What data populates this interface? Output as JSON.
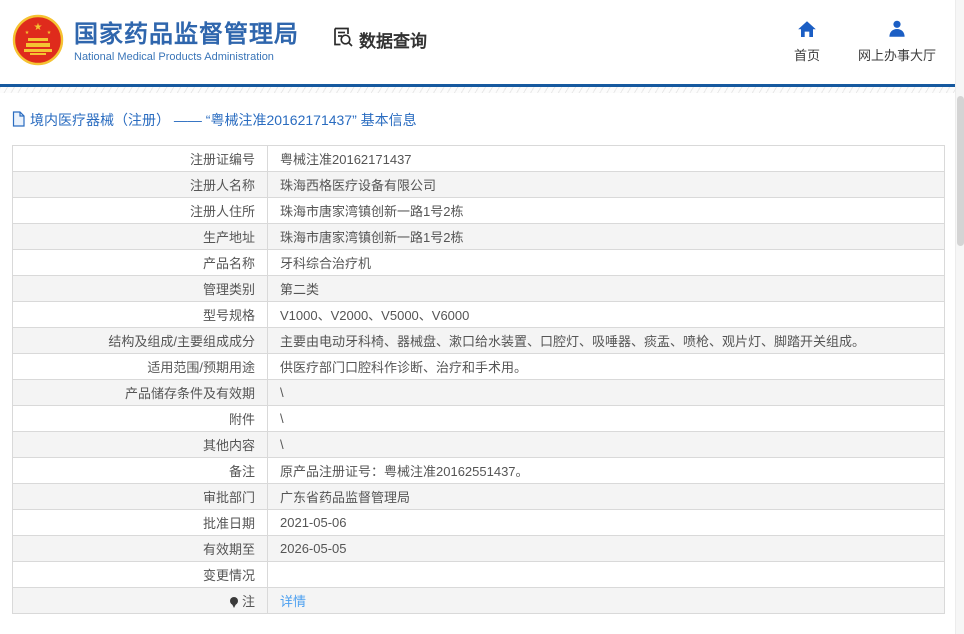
{
  "header": {
    "org_name_cn": "国家药品监督管理局",
    "org_name_en": "National Medical Products Administration",
    "query_label": "数据查询",
    "nav": [
      {
        "label": "首页",
        "icon": "home-icon"
      },
      {
        "label": "网上办事大厅",
        "icon": "person-icon"
      }
    ]
  },
  "breadcrumb": {
    "text": "境内医疗器械（注册） —— “粤械注准20162171437” 基本信息",
    "icon": "document-icon"
  },
  "table": {
    "rows": [
      {
        "label": "注册证编号",
        "value": "粤械注准20162171437"
      },
      {
        "label": "注册人名称",
        "value": "珠海西格医疗设备有限公司"
      },
      {
        "label": "注册人住所",
        "value": "珠海市唐家湾镇创新一路1号2栋"
      },
      {
        "label": "生产地址",
        "value": "珠海市唐家湾镇创新一路1号2栋"
      },
      {
        "label": "产品名称",
        "value": "牙科综合治疗机"
      },
      {
        "label": "管理类别",
        "value": "第二类"
      },
      {
        "label": "型号规格",
        "value": "V1000、V2000、V5000、V6000"
      },
      {
        "label": "结构及组成/主要组成成分",
        "value": "主要由电动牙科椅、器械盘、漱口给水装置、口腔灯、吸唾器、痰盂、喷枪、观片灯、脚踏开关组成。"
      },
      {
        "label": "适用范围/预期用途",
        "value": "供医疗部门口腔科作诊断、治疗和手术用。"
      },
      {
        "label": "产品储存条件及有效期",
        "value": "\\"
      },
      {
        "label": "附件",
        "value": "\\"
      },
      {
        "label": "其他内容",
        "value": "\\"
      },
      {
        "label": "备注",
        "value": "原产品注册证号：粤械注准20162551437。"
      },
      {
        "label": "审批部门",
        "value": "广东省药品监督管理局"
      },
      {
        "label": "批准日期",
        "value": "2021-05-06"
      },
      {
        "label": "有效期至",
        "value": "2026-05-05"
      },
      {
        "label": "变更情况",
        "value": ""
      },
      {
        "label": "注",
        "value": "详情",
        "is_link": true,
        "label_icon": "pin-icon"
      }
    ]
  },
  "colors": {
    "header_line_blue": "#16599f",
    "brand_blue": "#2f66ad",
    "breadcrumb_blue": "#2a6cc0",
    "nav_icon_blue": "#1b5ec4",
    "link_blue": "#4da0f0",
    "emblem_red": "#df2b1c",
    "emblem_gold": "#f5c332",
    "row_alt_bg": "#f4f4f4",
    "border_gray": "#d9d9d9"
  }
}
